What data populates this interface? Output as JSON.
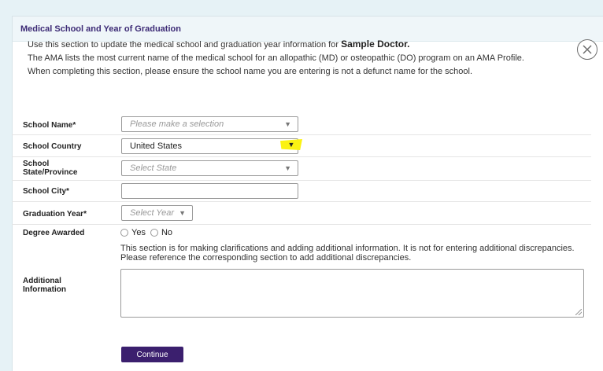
{
  "section_title": "Medical School and Year of Graduation",
  "intro": {
    "line1_prefix": "Use this section to update the medical school and graduation year information for ",
    "line1_name": "Sample Doctor.",
    "line2": "The AMA lists the most current name of the medical school for an allopathic (MD) or osteopathic (DO) program on an AMA Profile.",
    "line3": "When completing this section, please ensure the school name you are entering is not a defunct name for the school."
  },
  "fields": {
    "school_name": {
      "label": "School Name*",
      "placeholder": "Please make a selection"
    },
    "school_country": {
      "label": "School Country",
      "value": "United States"
    },
    "school_state": {
      "label_line1": "School",
      "label_line2": "State/Province",
      "placeholder": "Select State"
    },
    "school_city": {
      "label": "School City*",
      "value": ""
    },
    "graduation_year": {
      "label": "Graduation Year*",
      "placeholder": "Select Year"
    },
    "degree_awarded": {
      "label": "Degree Awarded",
      "option_yes": "Yes",
      "option_no": "No"
    },
    "additional_info": {
      "label_line1": "Additional",
      "label_line2": "Information",
      "note": "This section is for making clarifications and adding additional information. It is not for entering additional discrepancies. Please reference the corresponding section to add additional discrepancies."
    }
  },
  "continue_label": "Continue",
  "icons": {
    "close": "close-icon",
    "dropdown": "chevron-down-icon"
  },
  "colors": {
    "accent": "#3b1f6e",
    "title": "#3c2a75",
    "highlight": "#fbf212",
    "background": "#e6f2f6"
  }
}
